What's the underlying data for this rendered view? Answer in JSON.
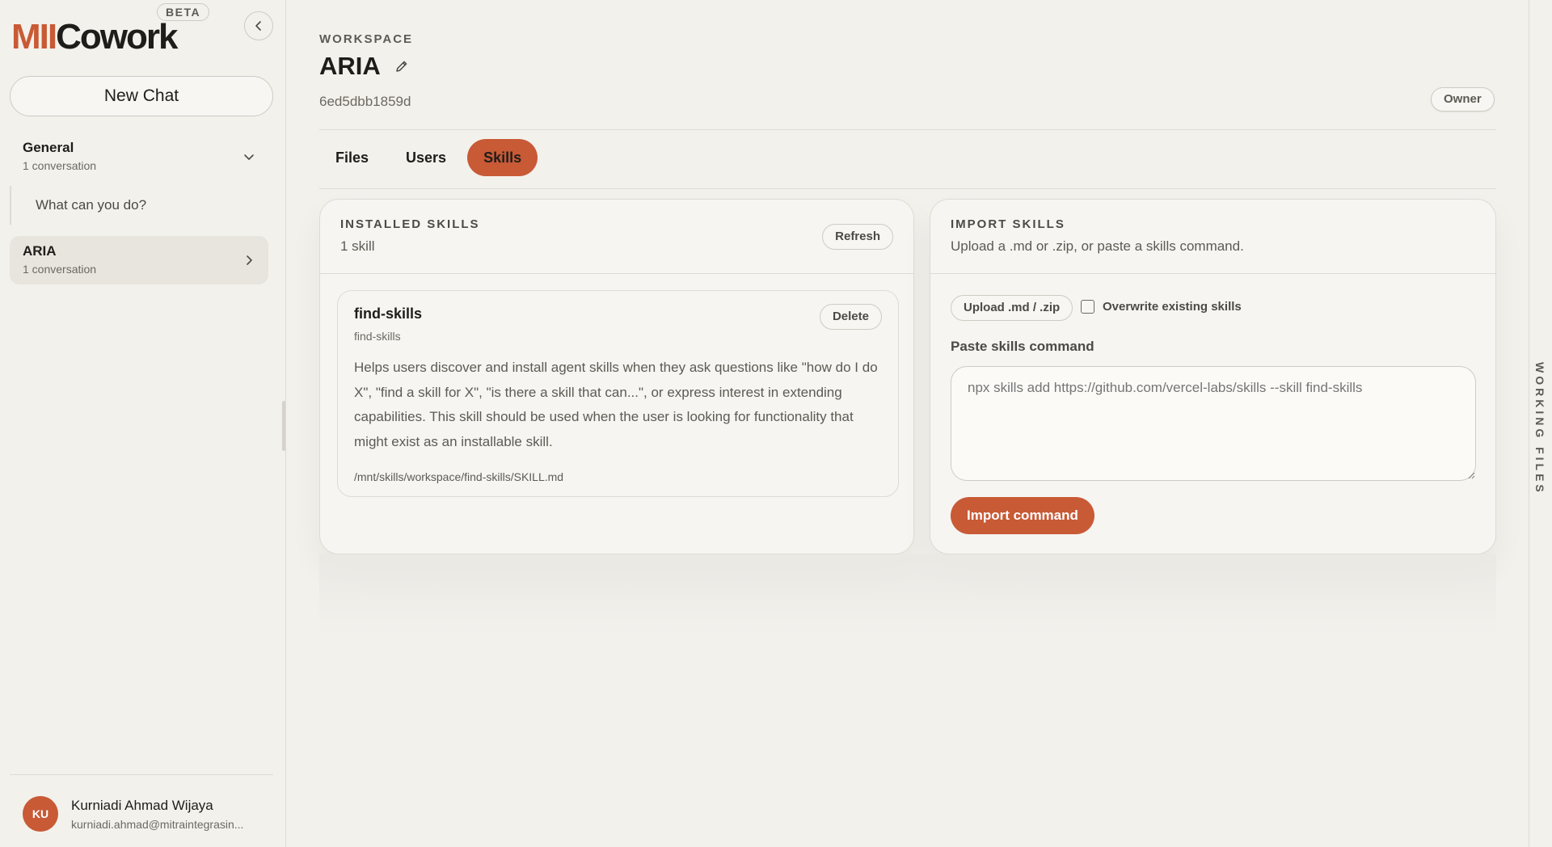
{
  "sidebar": {
    "logo_brand": "MII",
    "logo_name": "Cowork",
    "beta": "BETA",
    "new_chat": "New Chat",
    "groups": [
      {
        "title": "General",
        "sub": "1 conversation"
      },
      {
        "title": "ARIA",
        "sub": "1 conversation"
      }
    ],
    "conversation": "What can you do?",
    "user": {
      "initials": "KU",
      "name": "Kurniadi Ahmad Wijaya",
      "email": "kurniadi.ahmad@mitraintegrasin..."
    }
  },
  "workspace": {
    "label": "WORKSPACE",
    "title": "ARIA",
    "id": "6ed5dbb1859d",
    "role": "Owner"
  },
  "tabs": [
    "Files",
    "Users",
    "Skills"
  ],
  "installed": {
    "title": "INSTALLED SKILLS",
    "count": "1 skill",
    "refresh": "Refresh",
    "skill": {
      "name": "find-skills",
      "sub": "find-skills",
      "delete": "Delete",
      "description": "Helps users discover and install agent skills when they ask questions like \"how do I do X\", \"find a skill for X\", \"is there a skill that can...\", or express interest in extending capabilities. This skill should be used when the user is looking for functionality that might exist as an installable skill.",
      "path": "/mnt/skills/workspace/find-skills/SKILL.md"
    }
  },
  "import": {
    "title": "IMPORT SKILLS",
    "sub": "Upload a .md or .zip, or paste a skills command.",
    "upload": "Upload .md / .zip",
    "overwrite": "Overwrite existing skills",
    "paste_label": "Paste skills command",
    "command_placeholder": "npx skills add https://github.com/vercel-labs/skills --skill find-skills",
    "import_button": "Import command"
  },
  "right_rail": "WORKING FILES",
  "colors": {
    "accent": "#c85a36",
    "background": "#f3f1ec",
    "text": "#1f1d1a"
  }
}
